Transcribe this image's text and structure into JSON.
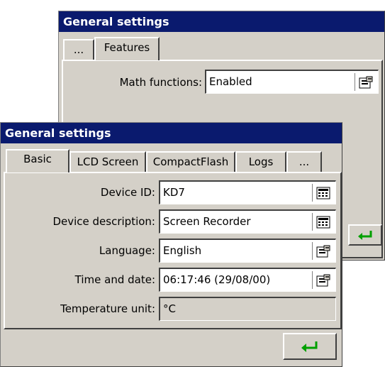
{
  "back_window": {
    "title": "General settings",
    "tabs": [
      "...",
      "Features"
    ],
    "field": {
      "label": "Math functions:",
      "value": "Enabled",
      "icon": "properties-icon"
    }
  },
  "front_window": {
    "title": "General settings",
    "tabs": [
      "Basic",
      "LCD Screen",
      "CompactFlash",
      "Logs",
      "..."
    ],
    "fields": [
      {
        "label": "Device ID:",
        "value": "KD7",
        "icon": "keypad-icon"
      },
      {
        "label": "Device description:",
        "value": "Screen Recorder",
        "icon": "keypad-icon"
      },
      {
        "label": "Language:",
        "value": "English",
        "icon": "properties-icon"
      },
      {
        "label": "Time and date:",
        "value": "06:17:46 (29/08/00)",
        "icon": "properties-icon"
      },
      {
        "label": "Temperature unit:",
        "value": "°C"
      }
    ]
  },
  "colors": {
    "titlebar": "#0a1a6e",
    "face": "#d4d0c8",
    "enter_arrow": "#00a000"
  }
}
